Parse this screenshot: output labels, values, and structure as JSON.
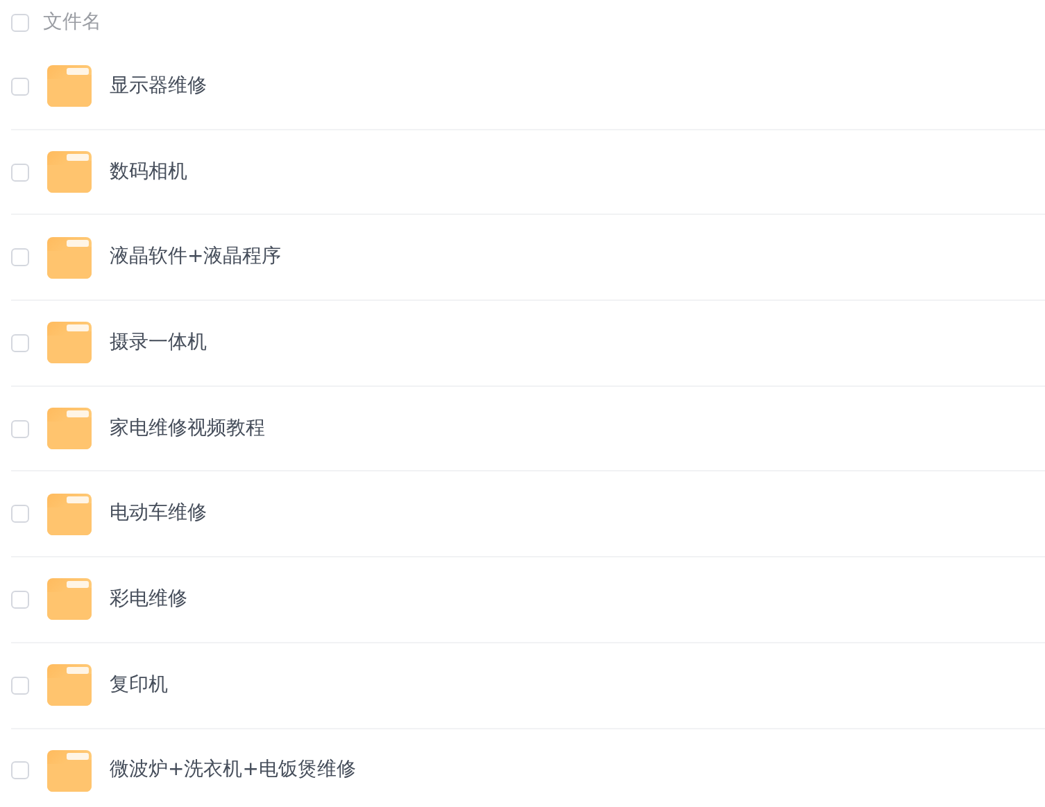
{
  "header": {
    "label": "文件名",
    "checked": false
  },
  "files": [
    {
      "name": "显示器维修",
      "checked": false
    },
    {
      "name": "数码相机",
      "checked": false
    },
    {
      "name": "液晶软件+液晶程序",
      "checked": false
    },
    {
      "name": "摄录一体机",
      "checked": false
    },
    {
      "name": "家电维修视频教程",
      "checked": false
    },
    {
      "name": "电动车维修",
      "checked": false
    },
    {
      "name": "彩电维修",
      "checked": false
    },
    {
      "name": "复印机",
      "checked": false
    },
    {
      "name": "微波炉+洗衣机+电饭煲维修",
      "checked": false
    }
  ]
}
